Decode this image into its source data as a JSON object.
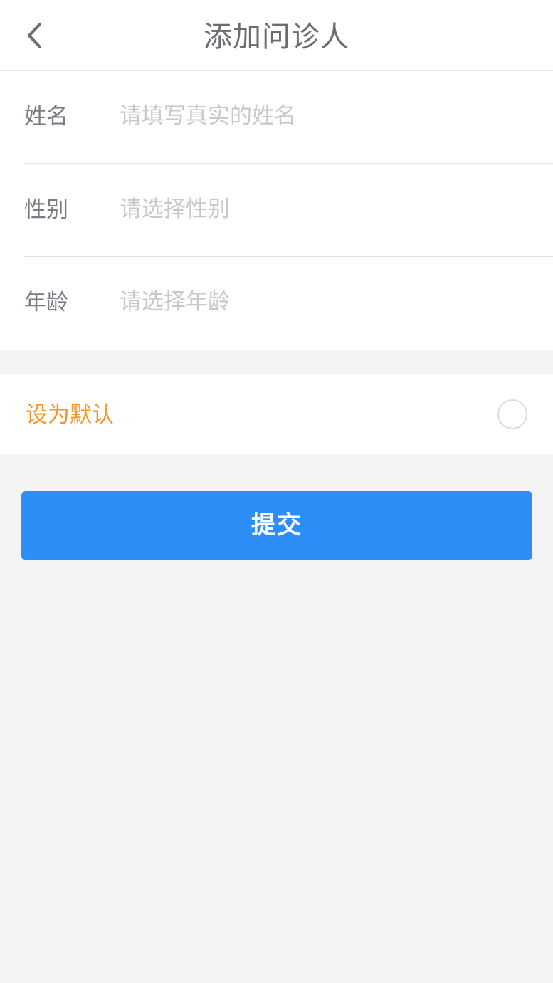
{
  "header": {
    "title": "添加问诊人",
    "back_icon": "chevron-left-icon"
  },
  "form": {
    "name": {
      "label": "姓名",
      "placeholder": "请填写真实的姓名"
    },
    "gender": {
      "label": "性别",
      "placeholder": "请选择性别"
    },
    "age": {
      "label": "年龄",
      "placeholder": "请选择年龄"
    }
  },
  "default_setting": {
    "label": "设为默认",
    "checked": false
  },
  "submit": {
    "label": "提交"
  },
  "colors": {
    "accent": "#2e8ef7",
    "default_label": "#f2962a",
    "background": "#f4f4f4"
  }
}
